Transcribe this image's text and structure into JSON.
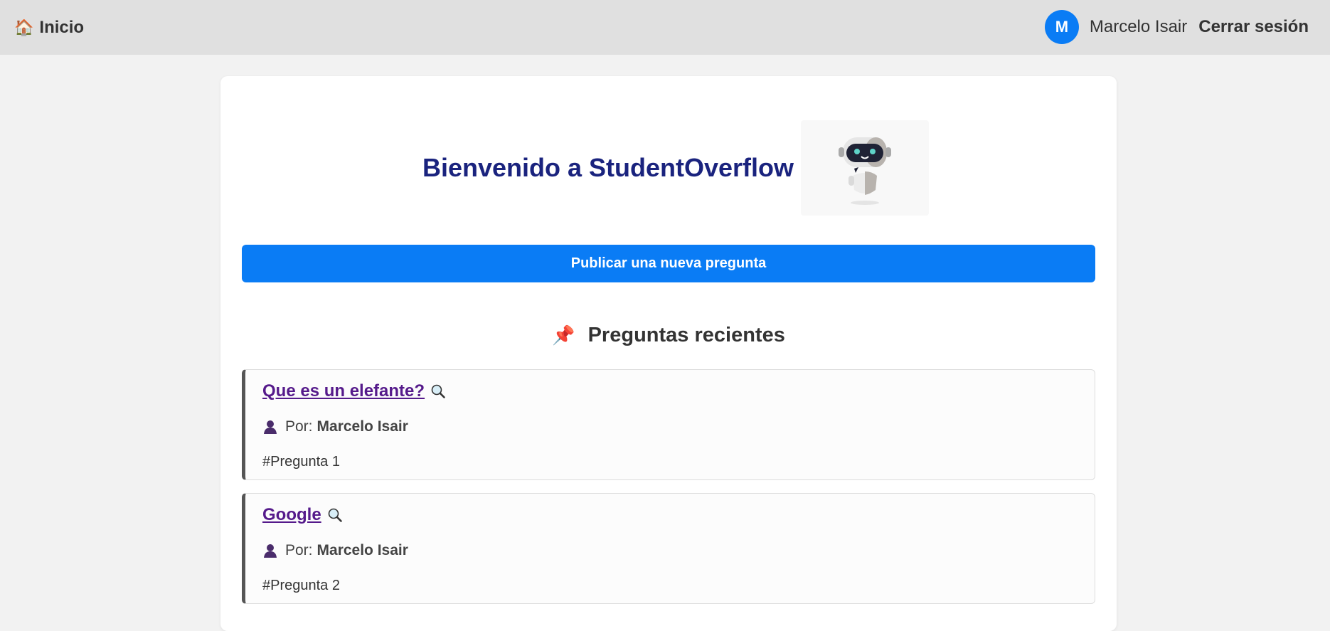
{
  "nav": {
    "home_icon": "house-icon",
    "home_label": "Inicio",
    "user_initial": "M",
    "user_name": "Marcelo Isair",
    "logout_label": "Cerrar sesión",
    "accent": "#0a7cf5"
  },
  "hero": {
    "title": "Bienvenido a StudentOverflow",
    "title_color": "#1a237e",
    "image": "robot-illustration"
  },
  "publish_button": {
    "label": "Publicar una nueva pregunta"
  },
  "recent": {
    "icon": "pushpin-icon",
    "title": "Preguntas recientes"
  },
  "questions": [
    {
      "title": "Que es un elefante?",
      "by_label": "Por:",
      "author": "Marcelo Isair",
      "tag": "#Pregunta 1"
    },
    {
      "title": "Google",
      "by_label": "Por:",
      "author": "Marcelo Isair",
      "tag": "#Pregunta 2"
    }
  ]
}
